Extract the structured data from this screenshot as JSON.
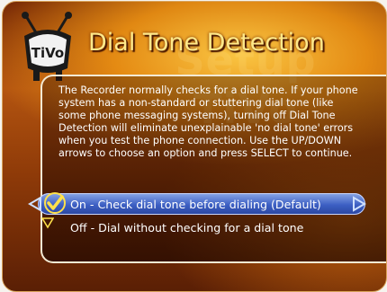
{
  "app": {
    "brand": "TiVo",
    "watermark": "Setup TiVo"
  },
  "header": {
    "title": "Dial Tone Detection"
  },
  "description": {
    "lines": [
      "The Recorder normally checks for a dial tone.  If your phone",
      "system has a non-standard or stuttering dial tone (like",
      "some phone messaging systems), turning off Dial Tone",
      "Detection will eliminate unexplainable 'no dial tone' errors",
      "when you test the phone connection.  Use the UP/DOWN",
      "arrows to choose an option and press SELECT to continue."
    ]
  },
  "options": [
    {
      "label": "On - Check dial tone before dialing (Default)",
      "selected": true
    },
    {
      "label": "Off - Dial without checking for a dial tone",
      "selected": false
    }
  ],
  "colors": {
    "title": "#ffe98a",
    "highlight": "#3c5fc3",
    "checkmark": "#ffe14a",
    "background": "#b35410"
  },
  "icons": [
    "tivo-logo-icon",
    "left-arrow-icon",
    "right-arrow-icon",
    "checkmark-icon",
    "down-arrow-icon"
  ]
}
